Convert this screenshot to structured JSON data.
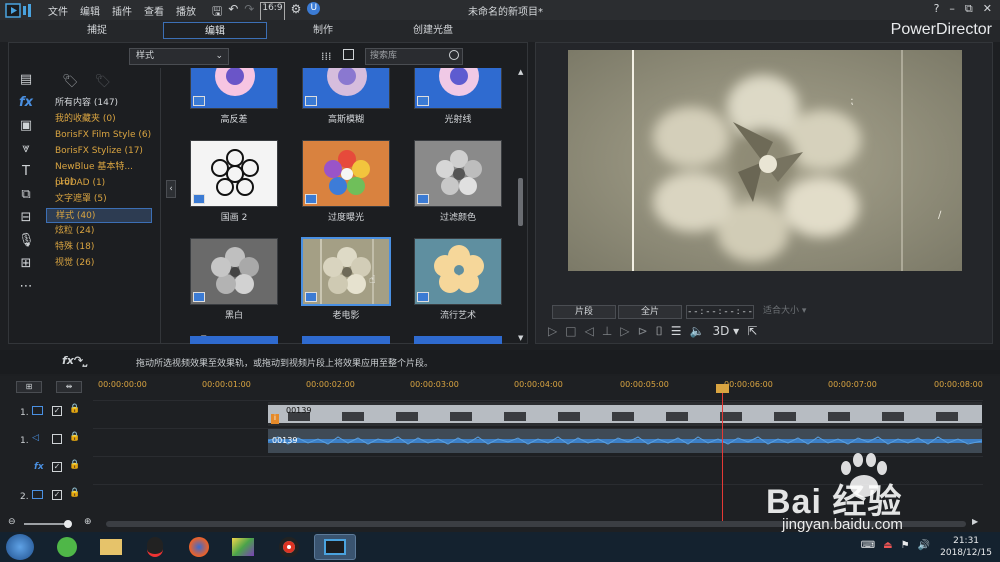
{
  "menubar": {
    "items": [
      "文件",
      "编辑",
      "插件",
      "查看",
      "播放"
    ],
    "window_title": "未命名的新项目*",
    "window_controls": [
      "?",
      "–",
      "⧉",
      "✕"
    ]
  },
  "tabs": {
    "capture": "捕捉",
    "edit": "编辑",
    "produce": "制作",
    "disc": "创建光盘",
    "active": "编辑"
  },
  "brand": "PowerDirector",
  "library": {
    "style_select": "样式",
    "search_placeholder": "搜索库",
    "categories": [
      {
        "label": "所有内容 (147)",
        "kind": "head"
      },
      {
        "label": "我的收藏夹  (0)",
        "kind": "item"
      },
      {
        "label": "BorisFX Film Style  (6)",
        "kind": "item"
      },
      {
        "label": "BorisFX Stylize  (17)",
        "kind": "item"
      },
      {
        "label": "NewBlue 基本特...  (10)",
        "kind": "item"
      },
      {
        "label": "proDAD  (1)",
        "kind": "item"
      },
      {
        "label": "文字遮罩  (5)",
        "kind": "item"
      },
      {
        "label": "样式  (40)",
        "kind": "selected"
      },
      {
        "label": "炫粒  (24)",
        "kind": "item"
      },
      {
        "label": "特殊  (18)",
        "kind": "item"
      },
      {
        "label": "视觉  (26)",
        "kind": "item"
      }
    ],
    "thumbnails": [
      {
        "label": "高反差"
      },
      {
        "label": "高斯模糊"
      },
      {
        "label": "光射线"
      },
      {
        "label": "国画 2"
      },
      {
        "label": "过度曝光"
      },
      {
        "label": "过滤颜色"
      },
      {
        "label": "黑白"
      },
      {
        "label": "老电影",
        "selected": true
      },
      {
        "label": "流行艺术"
      }
    ]
  },
  "preview": {
    "clip_button": "片段",
    "movie_button": "全片",
    "timecode": "- - : - - : - - : - -",
    "zoom_select": "适合大小",
    "mode_3d": "3D"
  },
  "hint": "拖动所选视频效果至效果轨，或拖动到视频片段上将效果应用至整个片段。",
  "timeline": {
    "ruler": [
      "00:00:00:00",
      "00:00:01:00",
      "00:00:02:00",
      "00:00:03:00",
      "00:00:04:00",
      "00:00:05:00",
      "00:00:06:00",
      "00:00:07:00",
      "00:00:08:00"
    ],
    "tracks": [
      {
        "label": "1.",
        "type": "video"
      },
      {
        "label": "1.",
        "type": "audio"
      },
      {
        "label": "fx",
        "type": "fx"
      },
      {
        "label": "2.",
        "type": "video"
      }
    ],
    "video_clip": "00139",
    "audio_clip": "00139"
  },
  "taskbar": {
    "time": "21:31",
    "date": "2018/12/15"
  },
  "watermark": {
    "brand": "Bai 经验",
    "url": "jingyan.baidu.com"
  }
}
